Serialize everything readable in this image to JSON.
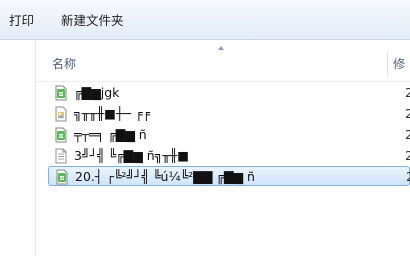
{
  "toolbar": {
    "print_label": "打印",
    "new_folder_label": "新建文件夹"
  },
  "columns": {
    "name": "名称",
    "next": "修"
  },
  "files": [
    {
      "name": "╔▇▆jgk",
      "date_fragment": "2",
      "icon": "green-document-icon"
    },
    {
      "name": "╗╥╥╫■┼─ ╒╒",
      "date_fragment": "2",
      "icon": "document-image-icon"
    },
    {
      "name": "╤┬═╕ ╔▇▆ ñ",
      "date_fragment": "2",
      "icon": "green-document-icon"
    },
    {
      "name": "3╝┘╣ ╚╔▇▆ ñ╗╥╫■",
      "date_fragment": "2",
      "icon": "text-file-icon"
    },
    {
      "name": "20.┤ ┌╚²╝┘╣ ╚ú¼╚²▇▇ ╔▇▆ ñ",
      "date_fragment": "2",
      "icon": "green-document-icon",
      "selected": true
    }
  ]
}
